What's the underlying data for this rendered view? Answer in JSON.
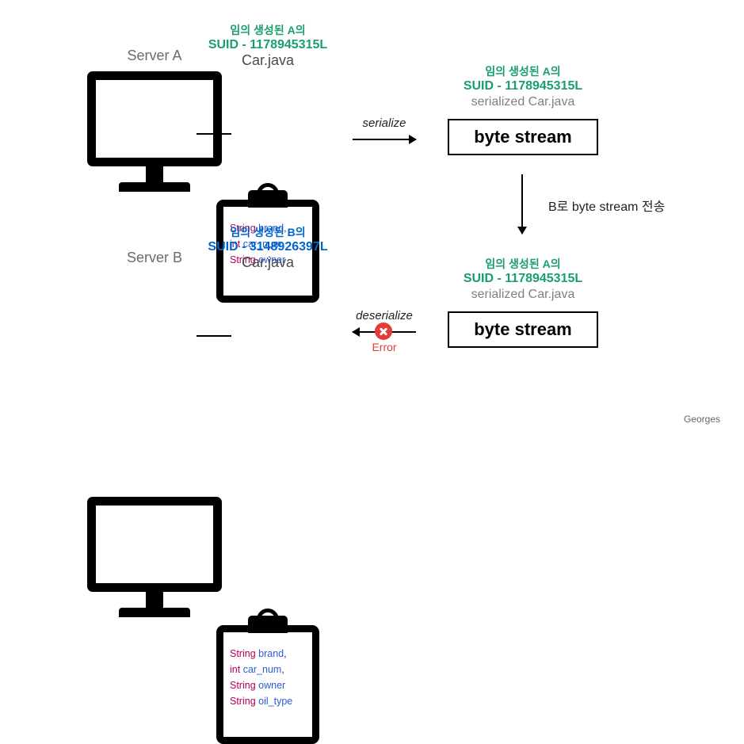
{
  "serverA": {
    "label": "Server A",
    "suid_line1": "임의 생성된  A의",
    "suid_line2": "SUID - 1178945315L",
    "class_file": "Car.java",
    "fields": [
      {
        "type": "String",
        "name": "brand",
        "comma": ","
      },
      {
        "type": "int",
        "name": "car_num",
        "comma": ","
      },
      {
        "type": "String",
        "name": "owner",
        "comma": ""
      }
    ]
  },
  "serverB": {
    "label": "Server B",
    "suid_line1": "임의 생성된  B의",
    "suid_line2": "SUID - 3148926397L",
    "class_file": "Car.java",
    "fields": [
      {
        "type": "String",
        "name": "brand",
        "comma": ","
      },
      {
        "type": "int",
        "name": "car_num",
        "comma": ","
      },
      {
        "type": "String",
        "name": "owner",
        "comma": ""
      },
      {
        "type": "String",
        "name": "oil_type",
        "comma": ""
      }
    ]
  },
  "serialize": {
    "action": "serialize",
    "suid_line1": "임의 생성된  A의",
    "suid_line2": "SUID - 1178945315L",
    "label": "serialized Car.java",
    "box": "byte stream"
  },
  "transfer": {
    "label": "B로 byte stream 전송"
  },
  "received": {
    "suid_line1": "임의 생성된  A의",
    "suid_line2": "SUID - 1178945315L",
    "label": "serialized Car.java",
    "box": "byte stream"
  },
  "deserialize": {
    "action": "deserialize",
    "error": "Error"
  },
  "author": "Georges"
}
